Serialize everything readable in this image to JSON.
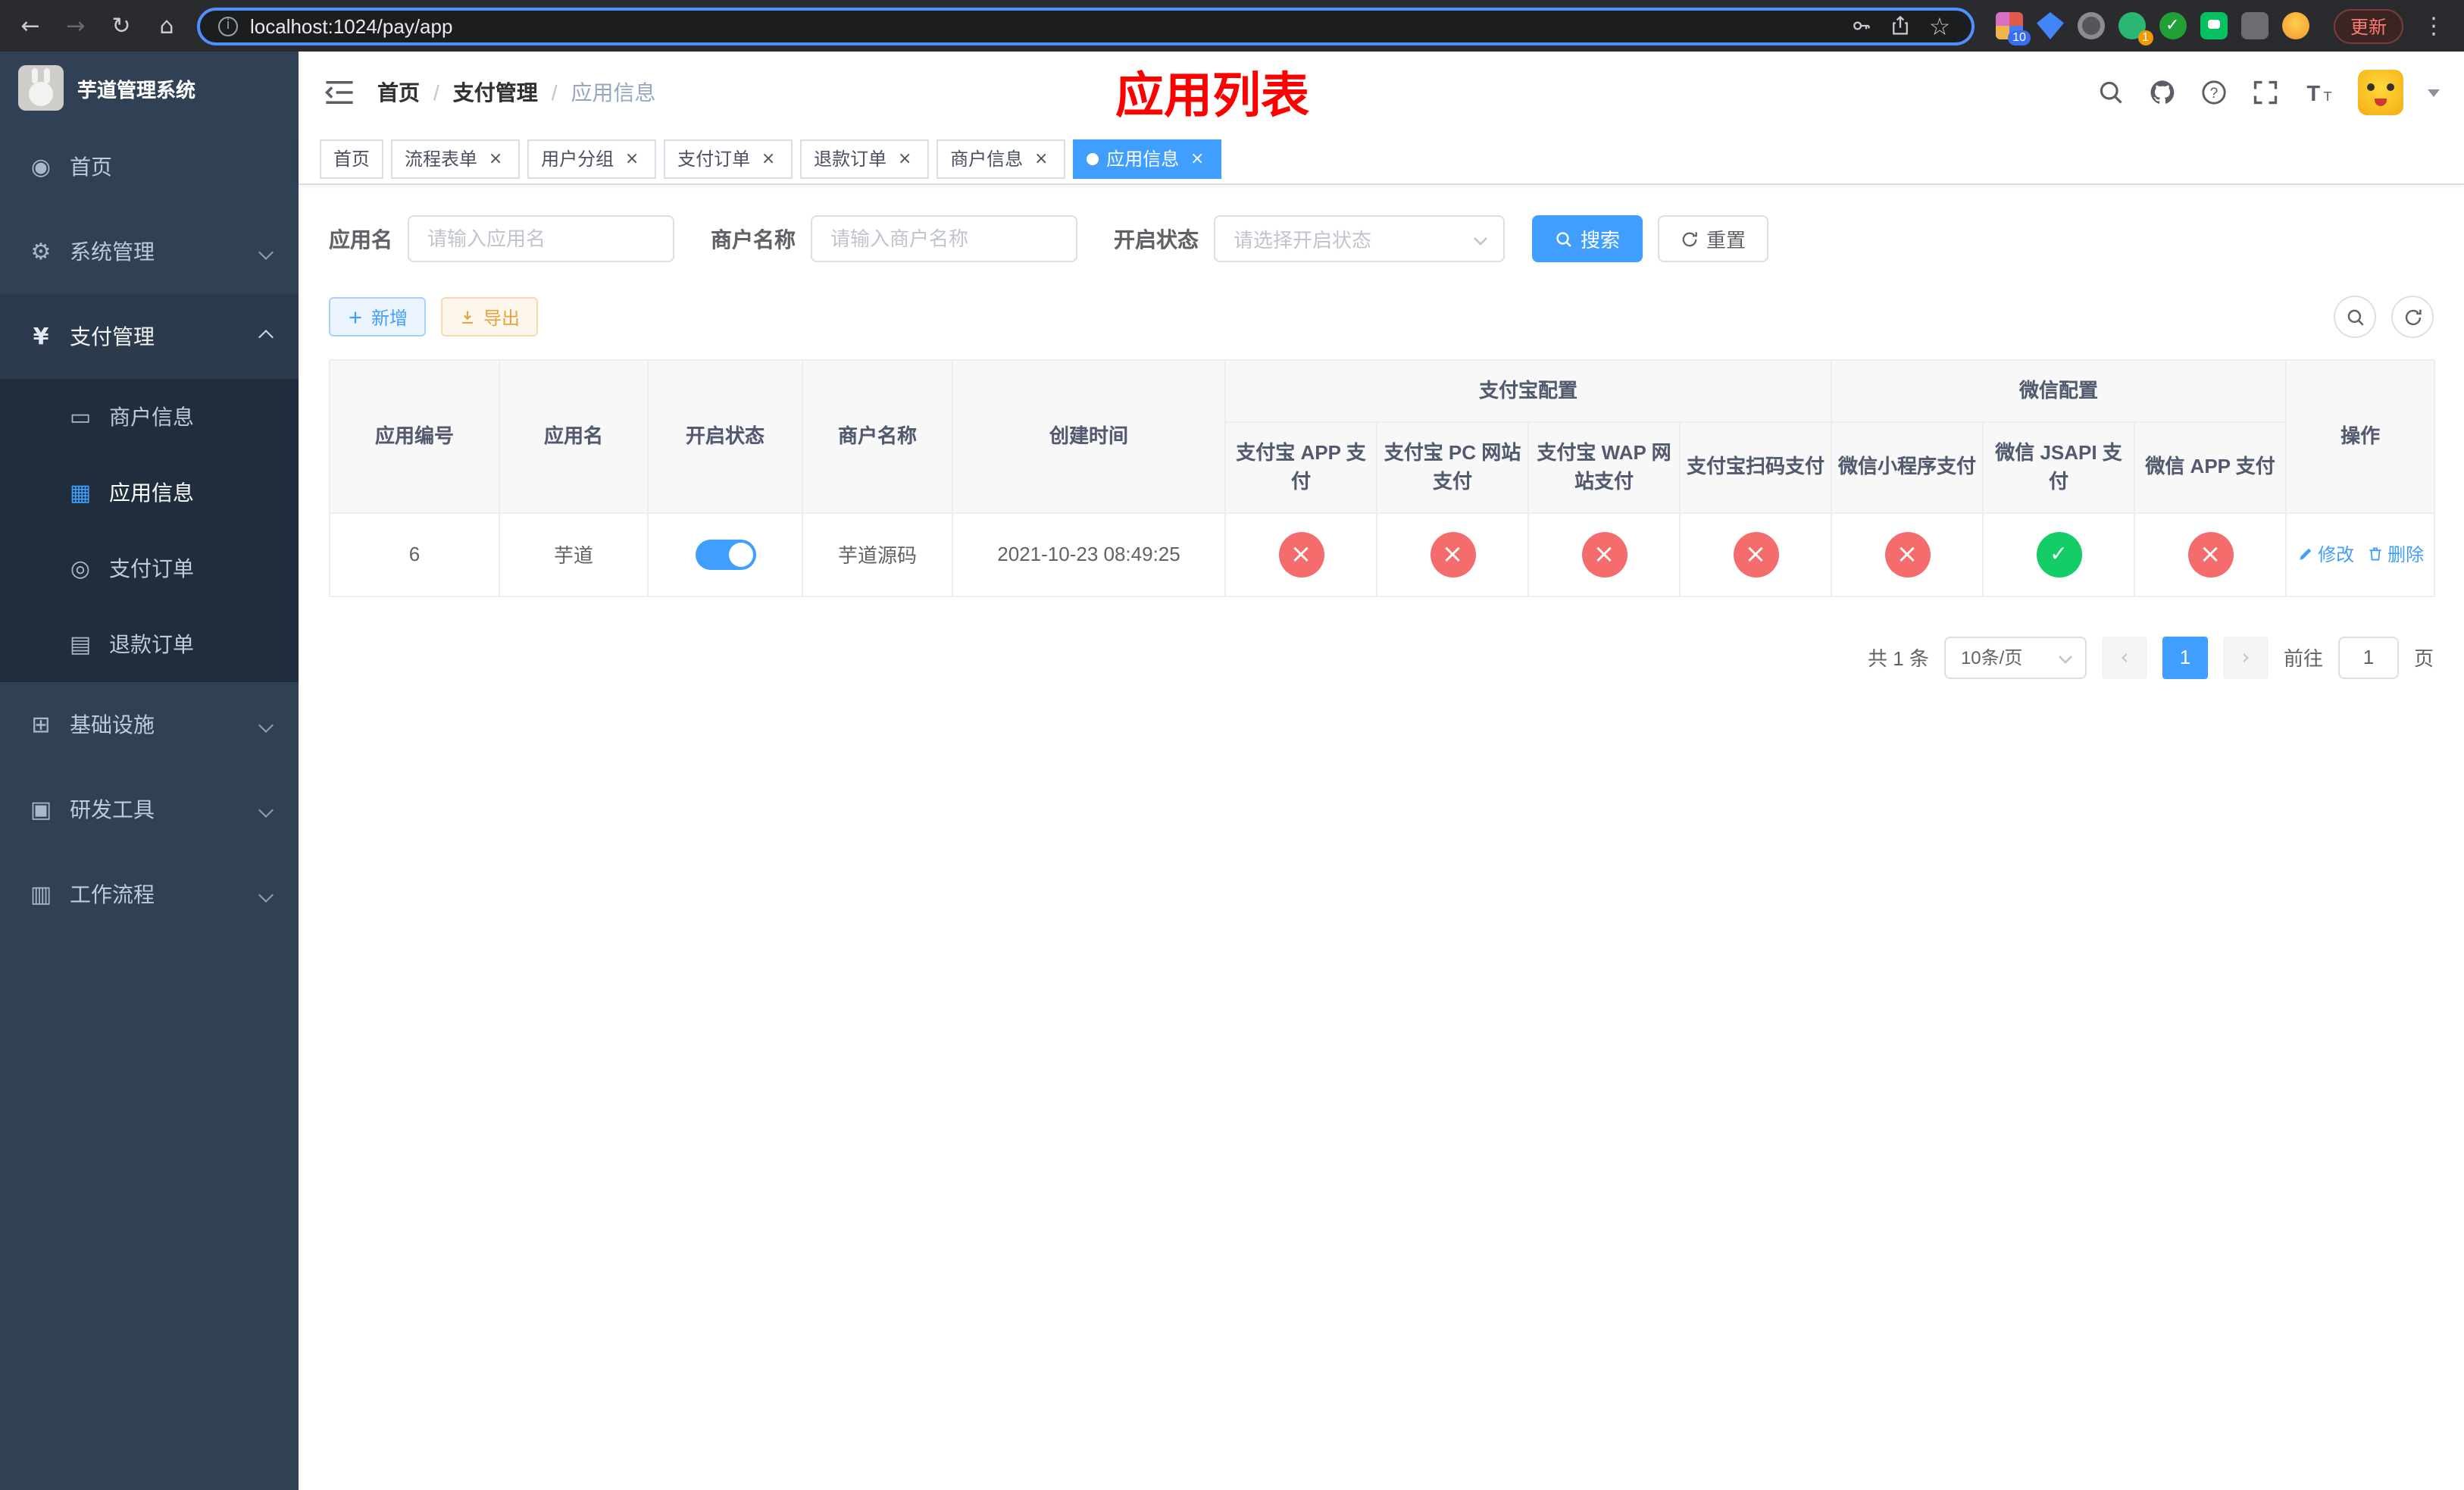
{
  "colors": {
    "accent": "#409eff",
    "success": "#13ce66",
    "danger": "#f56c6c",
    "warning": "#e6a23c"
  },
  "browser": {
    "url": "localhost:1024/pay/app",
    "update_button": "更新",
    "pixel_ext_badge": "10",
    "avatar_ext_badge": "1"
  },
  "sidebar": {
    "title": "芋道管理系统",
    "items": [
      {
        "label": "首页"
      },
      {
        "label": "系统管理"
      },
      {
        "label": "支付管理"
      },
      {
        "label": "基础设施"
      },
      {
        "label": "研发工具"
      },
      {
        "label": "工作流程"
      }
    ],
    "submenu": [
      {
        "label": "商户信息"
      },
      {
        "label": "应用信息"
      },
      {
        "label": "支付订单"
      },
      {
        "label": "退款订单"
      }
    ]
  },
  "navbar": {
    "breadcrumb": [
      "首页",
      "支付管理",
      "应用信息"
    ],
    "annotation": "应用列表"
  },
  "tags": [
    {
      "label": "首页"
    },
    {
      "label": "流程表单"
    },
    {
      "label": "用户分组"
    },
    {
      "label": "支付订单"
    },
    {
      "label": "退款订单"
    },
    {
      "label": "商户信息"
    },
    {
      "label": "应用信息"
    }
  ],
  "search": {
    "app_name_label": "应用名",
    "app_name_placeholder": "请输入应用名",
    "merchant_label": "商户名称",
    "merchant_placeholder": "请输入商户名称",
    "status_label": "开启状态",
    "status_placeholder": "请选择开启状态",
    "search_button": "搜索",
    "reset_button": "重置"
  },
  "toolbar": {
    "add_button": "新增",
    "export_button": "导出"
  },
  "table": {
    "columns": [
      "应用编号",
      "应用名",
      "开启状态",
      "商户名称",
      "创建时间"
    ],
    "group_alipay": "支付宝配置",
    "group_wechat": "微信配置",
    "alipay_columns": [
      "支付宝 APP 支付",
      "支付宝 PC 网站支付",
      "支付宝 WAP 网站支付",
      "支付宝扫码支付"
    ],
    "wechat_columns": [
      "微信小程序支付",
      "微信 JSAPI 支付",
      "微信 APP 支付"
    ],
    "action_column": "操作",
    "rows": [
      {
        "id": "6",
        "name": "芋道",
        "status_enabled": true,
        "merchant": "芋道源码",
        "created": "2021-10-23 08:49:25",
        "channels": [
          "disabled",
          "disabled",
          "disabled",
          "disabled",
          "disabled",
          "enabled",
          "disabled"
        ],
        "edit_label": "修改",
        "delete_label": "删除"
      }
    ]
  },
  "pagination": {
    "total": "共 1 条",
    "page_size": "10条/页",
    "current_page": "1",
    "goto_label": "前往",
    "goto_value": "1",
    "page_unit": "页"
  }
}
